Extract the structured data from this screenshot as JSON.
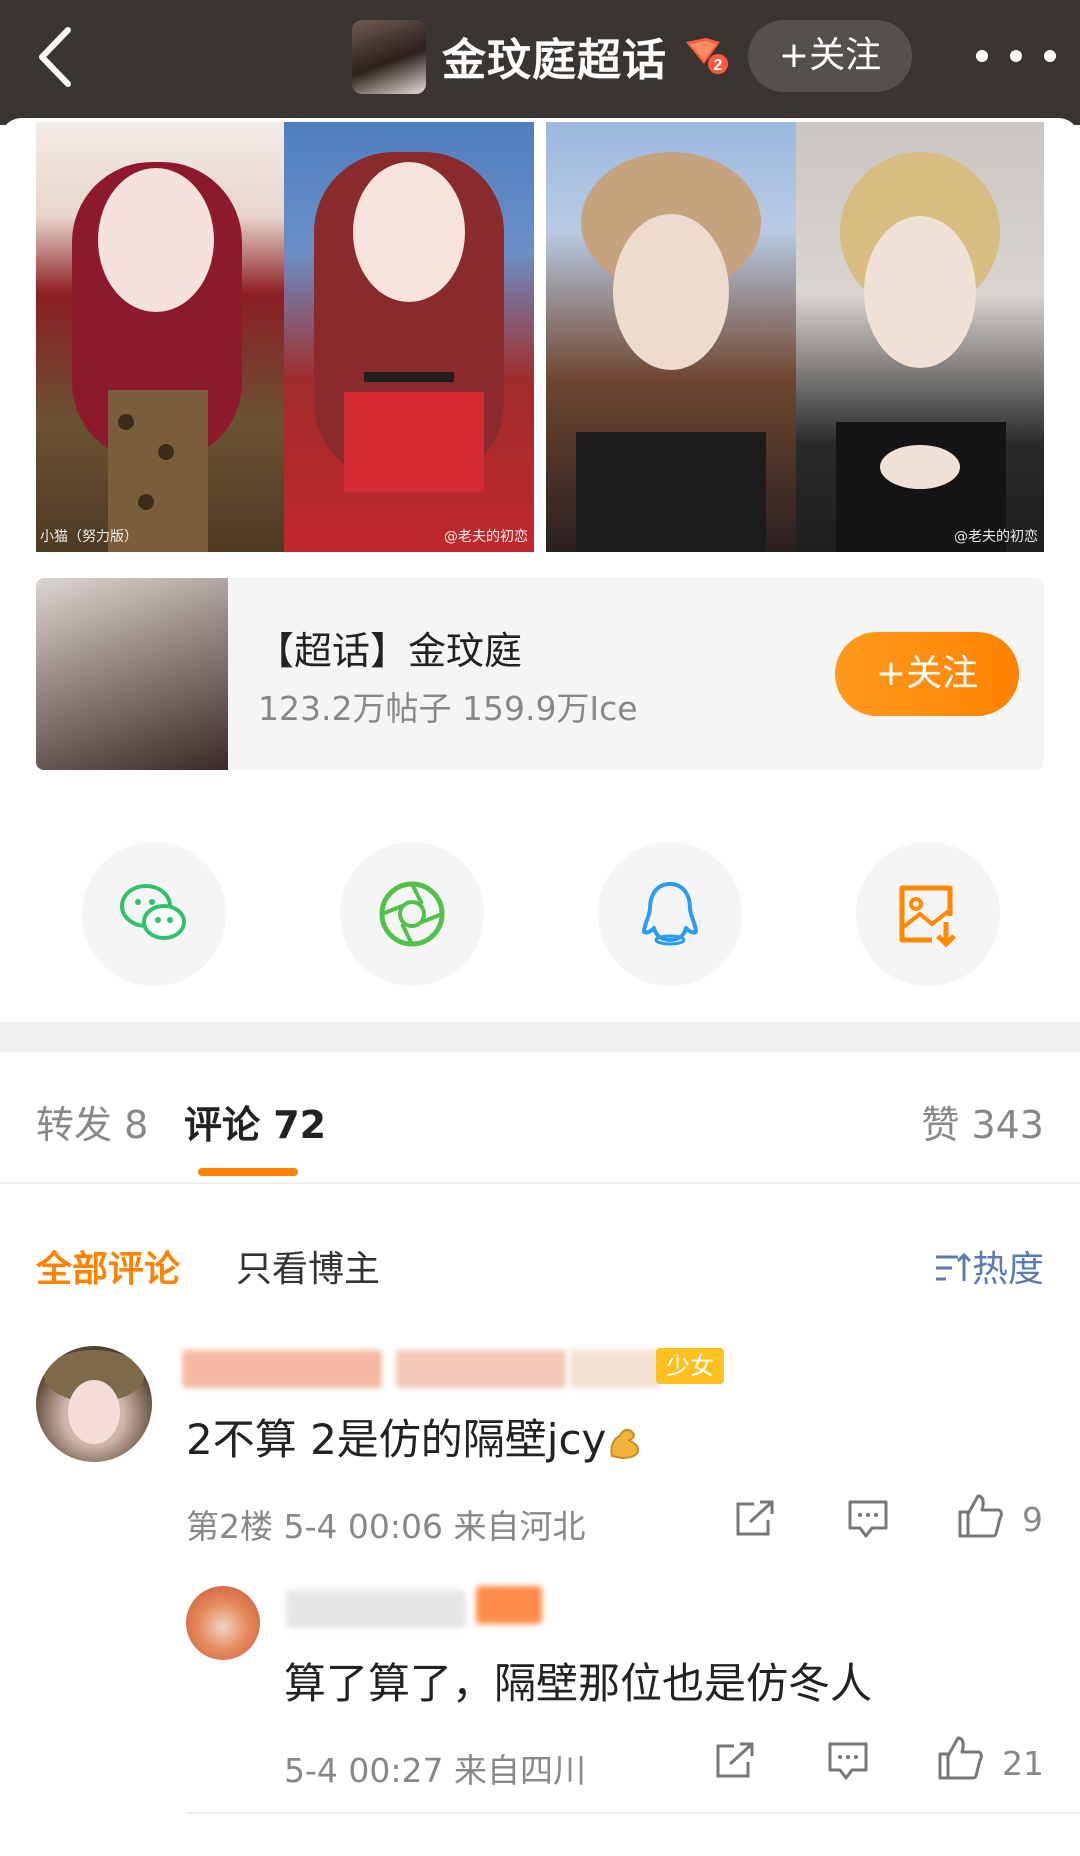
{
  "header": {
    "title": "金玟庭超话",
    "badge_level": "2",
    "follow_label": "+关注"
  },
  "photos": {
    "credit_left": "小猫（努力版）",
    "credit_mid": "@老夫的初恋",
    "credit_right": "@老夫的初恋"
  },
  "topic_card": {
    "name": "【超话】金玟庭",
    "stats": "123.2万帖子 159.9万Ice",
    "follow_label": "+关注"
  },
  "share_icons": [
    "wechat-icon",
    "moments-icon",
    "qq-icon",
    "save-image-icon"
  ],
  "colors": {
    "accent": "#ff8200",
    "topbar": "#3b3532",
    "sort_blue": "#5b7bb5",
    "badge_yellow": "#ffc122"
  },
  "tabs": {
    "forward": "转发 8",
    "comments": "评论 72",
    "likes": "赞 343"
  },
  "filters": {
    "all": "全部评论",
    "owner_only": "只看博主",
    "sort": "热度"
  },
  "comments": [
    {
      "badge": "少女",
      "text": "2不算 2是仿的隔壁jcy",
      "emoji": "flexed-biceps-icon",
      "floor": "第2楼",
      "time": "5-4 00:06",
      "location": "来自河北",
      "likes": "9",
      "reply": {
        "text": "算了算了，隔壁那位也是仿冬人",
        "time": "5-4 00:27",
        "location": "来自四川",
        "likes": "21"
      }
    }
  ]
}
